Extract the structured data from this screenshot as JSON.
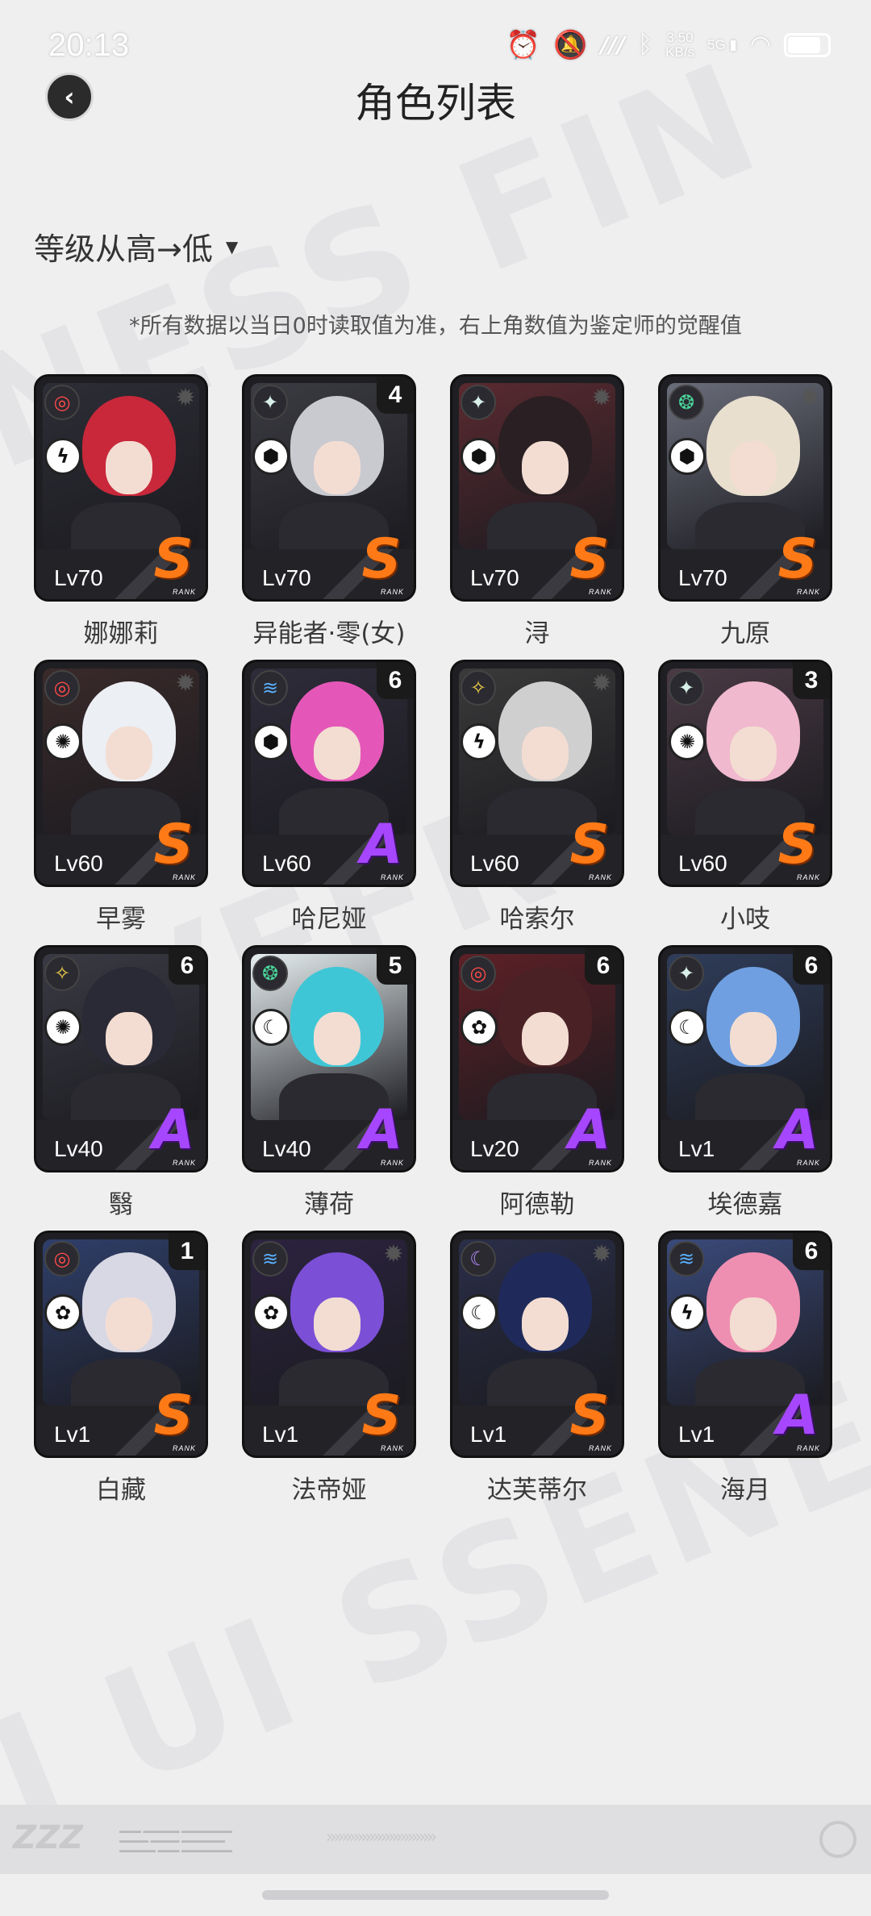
{
  "status_bar": {
    "time": "20:13",
    "icons": [
      "alarm-icon",
      "mute-icon",
      "nfc-icon",
      "bluetooth-icon",
      "signal-icon",
      "wifi-icon",
      "battery-icon"
    ],
    "net_speed_value": "3.50",
    "net_speed_unit": "KB/s",
    "network": "5G"
  },
  "header": {
    "title": "角色列表"
  },
  "sort": {
    "label": "等级从高→低"
  },
  "note": "*所有数据以当日0时读取值为准，右上角数值为鉴定师的觉醒值",
  "rank_word": "RANK",
  "characters": [
    {
      "name": "娜娜莉",
      "level": "Lv70",
      "rank": "S",
      "awakening": "",
      "attribute": "fire",
      "specialty": "anomaly",
      "accent": "#c8283a",
      "bg": "#2d2d36"
    },
    {
      "name": "异能者·零(女)",
      "level": "Lv70",
      "rank": "S",
      "awakening": "4",
      "attribute": "ether",
      "specialty": "defense",
      "accent": "#c9c9d0",
      "bg": "#3b3b42"
    },
    {
      "name": "浔",
      "level": "Lv70",
      "rank": "S",
      "awakening": "",
      "attribute": "ether",
      "specialty": "defense",
      "accent": "#2a1f22",
      "bg": "#5a2a30"
    },
    {
      "name": "九原",
      "level": "Lv70",
      "rank": "S",
      "awakening": "",
      "attribute": "wind",
      "specialty": "defense",
      "accent": "#e9dfcf",
      "bg": "#6a6d7a"
    },
    {
      "name": "早雾",
      "level": "Lv60",
      "rank": "S",
      "awakening": "",
      "attribute": "fire",
      "specialty": "support",
      "accent": "#eceff4",
      "bg": "#3a2a2a"
    },
    {
      "name": "哈尼娅",
      "level": "Lv60",
      "rank": "A",
      "awakening": "6",
      "attribute": "ice",
      "specialty": "defense",
      "accent": "#e457b8",
      "bg": "#2f2c3a"
    },
    {
      "name": "哈索尔",
      "level": "Lv60",
      "rank": "S",
      "awakening": "",
      "attribute": "electric",
      "specialty": "anomaly",
      "accent": "#cfcfcf",
      "bg": "#3a3a3a"
    },
    {
      "name": "小吱",
      "level": "Lv60",
      "rank": "S",
      "awakening": "3",
      "attribute": "ether",
      "specialty": "support",
      "accent": "#f0b9cd",
      "bg": "#4a3a44"
    },
    {
      "name": "翳",
      "level": "Lv40",
      "rank": "A",
      "awakening": "6",
      "attribute": "electric",
      "specialty": "support",
      "accent": "#2a2a36",
      "bg": "#3a3a44"
    },
    {
      "name": "薄荷",
      "level": "Lv40",
      "rank": "A",
      "awakening": "5",
      "attribute": "wind",
      "specialty": "attack",
      "accent": "#3fc6d6",
      "bg": "#e6eef0"
    },
    {
      "name": "阿德勒",
      "level": "Lv20",
      "rank": "A",
      "awakening": "6",
      "attribute": "fire",
      "specialty": "stun",
      "accent": "#4a2226",
      "bg": "#5d2026"
    },
    {
      "name": "埃德嘉",
      "level": "Lv1",
      "rank": "A",
      "awakening": "6",
      "attribute": "ether",
      "specialty": "attack",
      "accent": "#6f9fe0",
      "bg": "#2f3d5a"
    },
    {
      "name": "白藏",
      "level": "Lv1",
      "rank": "S",
      "awakening": "1",
      "attribute": "fire",
      "specialty": "stun",
      "accent": "#d8d8e4",
      "bg": "#2f3f6a"
    },
    {
      "name": "法帝娅",
      "level": "Lv1",
      "rank": "S",
      "awakening": "",
      "attribute": "ice",
      "specialty": "stun",
      "accent": "#7b4fd6",
      "bg": "#2c2340"
    },
    {
      "name": "达芙蒂尔",
      "level": "Lv1",
      "rank": "S",
      "awakening": "",
      "attribute": "dark",
      "specialty": "attack",
      "accent": "#1f2a5a",
      "bg": "#2a2e48"
    },
    {
      "name": "海月",
      "level": "Lv1",
      "rank": "A",
      "awakening": "6",
      "attribute": "ice",
      "specialty": "anomaly",
      "accent": "#ee8fb1",
      "bg": "#3a4a7a"
    }
  ],
  "colors": {
    "rank_s": "#ff7a16",
    "rank_a": "#a647ff",
    "background": "#efeff0"
  }
}
